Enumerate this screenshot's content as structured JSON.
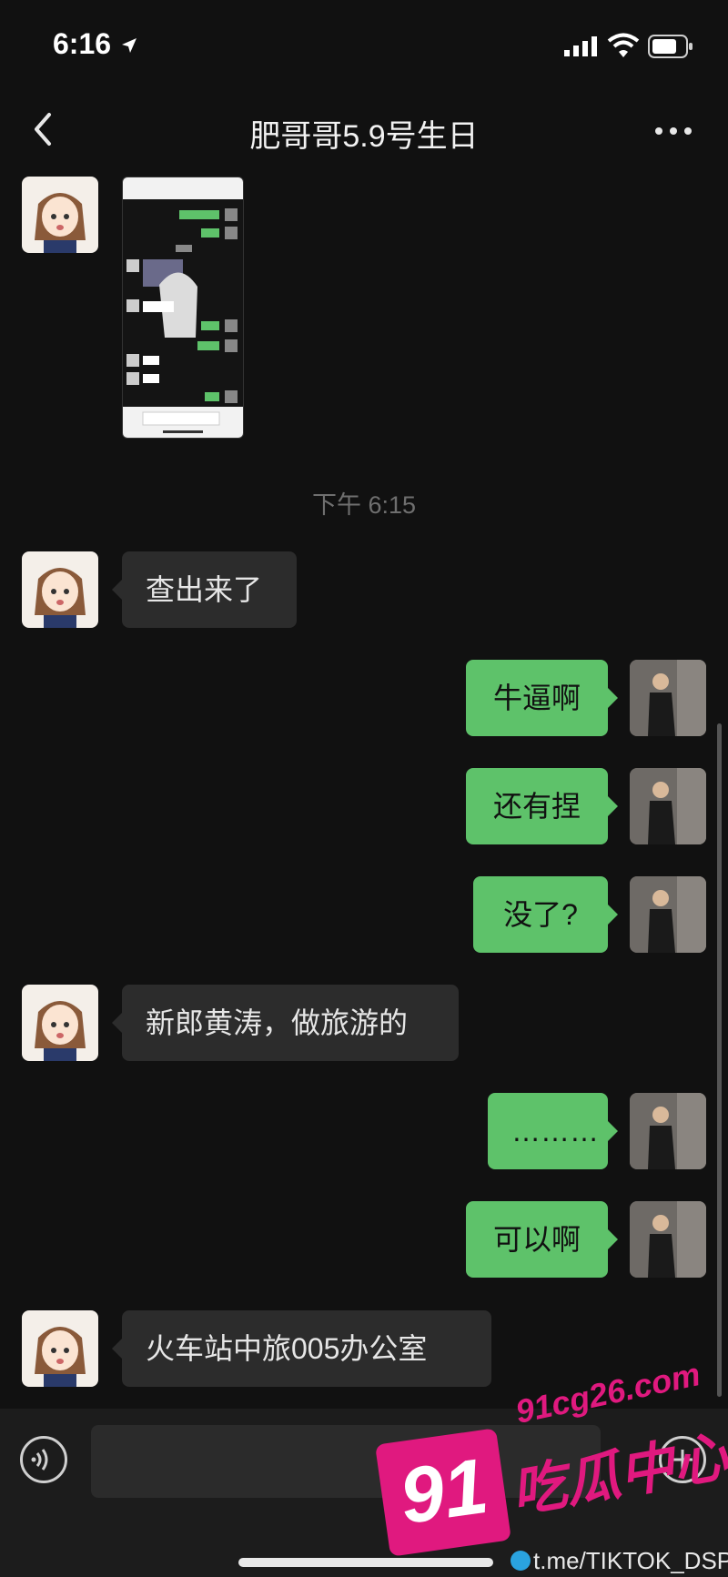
{
  "status_bar": {
    "time": "6:16"
  },
  "header": {
    "title": "肥哥哥5.9号生日"
  },
  "timestamp": "下午 6:15",
  "messages": [
    {
      "side": "in",
      "text": "查出来了"
    },
    {
      "side": "out",
      "text": "牛逼啊"
    },
    {
      "side": "out",
      "text": "还有捏"
    },
    {
      "side": "out",
      "text": "没了?"
    },
    {
      "side": "in",
      "text": "新郎黄涛，做旅游的"
    },
    {
      "side": "out",
      "text": "………"
    },
    {
      "side": "out",
      "text": "可以啊"
    },
    {
      "side": "in",
      "text": "火车站中旅005办公室"
    }
  ],
  "watermark": {
    "site": "91cg26.com",
    "logo": "91",
    "brand": "吃瓜中心",
    "telegram": "t.me/TIKTOK_DSP"
  },
  "colors": {
    "background": "#111111",
    "outgoing_bubble": "#5ec26a",
    "incoming_bubble": "#2c2c2c",
    "watermark": "#e0197f"
  },
  "icons": [
    "location-arrow-icon",
    "signal-icon",
    "wifi-icon",
    "battery-icon",
    "back-icon",
    "more-icon",
    "voice-icon",
    "plus-icon"
  ]
}
